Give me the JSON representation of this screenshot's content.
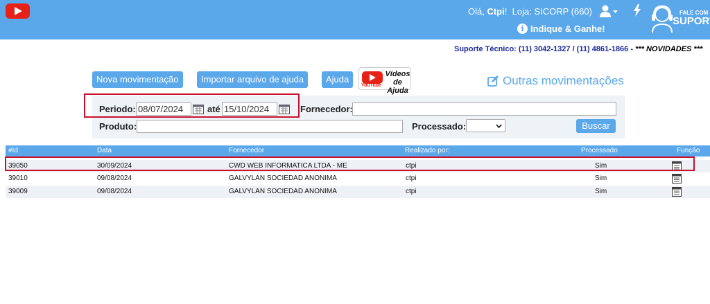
{
  "header": {
    "greeting_prefix": "Olá,",
    "user_name": "Ctpi",
    "greeting_suffix": "!",
    "store": "Loja: SICORP (660)",
    "indique": "Indique & Ganhe!",
    "fale_com": "FALE COM",
    "suporte": "SUPORTE"
  },
  "support_line": {
    "text": "Suporte Técnico: (11) 3042-1327 / (11) 4861-1866 - ",
    "novidades": "*** NOVIDADES ***"
  },
  "actions": {
    "nova": "Nova movimentação",
    "importar": "Importar arquivo de ajuda",
    "ajuda": "Ajuda",
    "videos_line1": "Vídeos",
    "videos_line2": "de Ajuda",
    "youtube": "YouTube",
    "outras": "Outras movimentações"
  },
  "filters": {
    "periodo_label": "Periodo:",
    "date_from": "08/07/2024",
    "ate_label": "até",
    "date_to": "15/10/2024",
    "fornecedor_label": "Fornecedor:",
    "fornecedor_value": "",
    "produto_label": "Produto:",
    "produto_value": "",
    "processado_label": "Processado:",
    "processado_value": "",
    "buscar": "Buscar"
  },
  "table": {
    "headers": [
      "#Id",
      "Data",
      "Fornecedor",
      "Realizado por:",
      "Processado",
      "Função"
    ],
    "rows": [
      {
        "id": "39050",
        "data": "30/09/2024",
        "fornecedor": "CWD WEB INFORMATICA LTDA - ME",
        "realizado": "ctpi",
        "processado": "Sim",
        "funcao_icon": "details-icon"
      },
      {
        "id": "39010",
        "data": "09/08/2024",
        "fornecedor": "GALVYLAN SOCIEDAD ANONIMA",
        "realizado": "ctpi",
        "processado": "Sim",
        "funcao_icon": "details-icon"
      },
      {
        "id": "39009",
        "data": "09/08/2024",
        "fornecedor": "GALVYLAN SOCIEDAD ANONIMA",
        "realizado": "ctpi",
        "processado": "Sim",
        "funcao_icon": "details-icon"
      }
    ]
  },
  "colors": {
    "primary": "#5aa7ea",
    "highlight": "#c8102e",
    "support_text": "#1a2a9a"
  }
}
